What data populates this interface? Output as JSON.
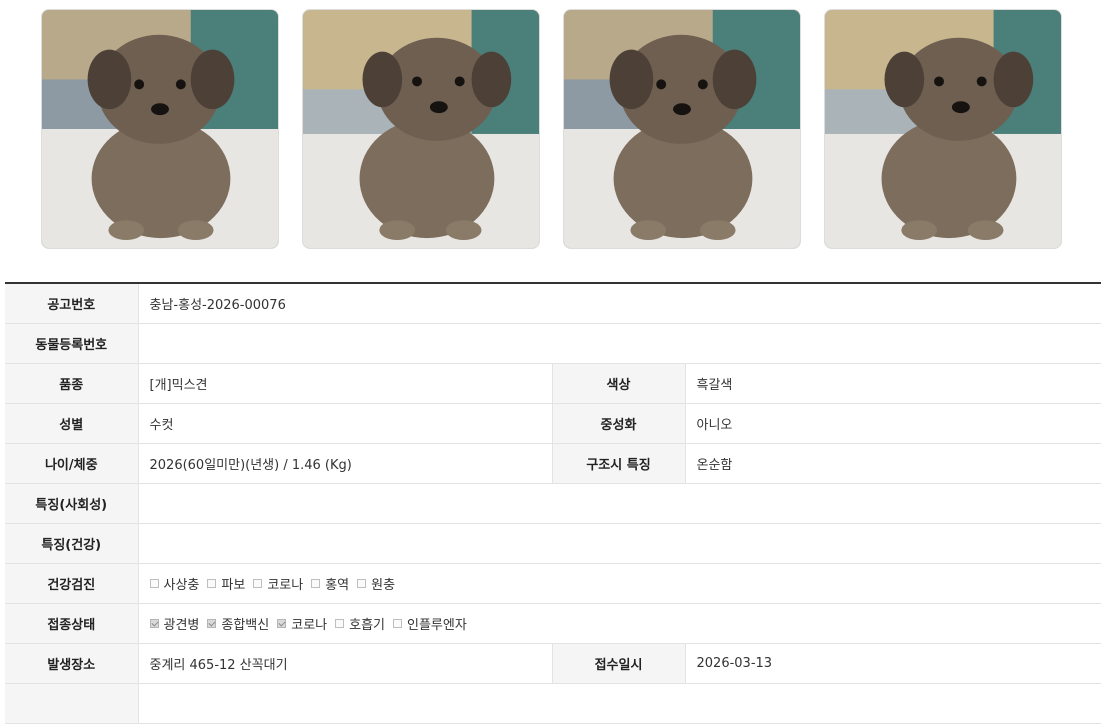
{
  "photos": [
    {
      "alt": "dog-photo-1"
    },
    {
      "alt": "dog-photo-2"
    },
    {
      "alt": "dog-photo-3"
    },
    {
      "alt": "dog-photo-4"
    }
  ],
  "info": {
    "notice_no": {
      "label": "공고번호",
      "value": "충남-홍성-2026-00076"
    },
    "reg_no": {
      "label": "동물등록번호",
      "value": ""
    },
    "breed": {
      "label": "품종",
      "value": "[개]믹스견"
    },
    "color": {
      "label": "색상",
      "value": "흑갈색"
    },
    "sex": {
      "label": "성별",
      "value": "수컷"
    },
    "neuter": {
      "label": "중성화",
      "value": "아니오"
    },
    "age_weight": {
      "label": "나이/체중",
      "value": "2026(60일미만)(년생) / 1.46 (Kg)"
    },
    "rescue_feature": {
      "label": "구조시 특징",
      "value": "온순함"
    },
    "feature_social": {
      "label": "특징(사회성)",
      "value": ""
    },
    "feature_health": {
      "label": "특징(건강)",
      "value": ""
    },
    "health_check": {
      "label": "건강검진",
      "items": [
        {
          "label": "사상충",
          "checked": false
        },
        {
          "label": "파보",
          "checked": false
        },
        {
          "label": "코로나",
          "checked": false
        },
        {
          "label": "홍역",
          "checked": false
        },
        {
          "label": "원충",
          "checked": false
        }
      ]
    },
    "vaccination": {
      "label": "접종상태",
      "items": [
        {
          "label": "광견병",
          "checked": true
        },
        {
          "label": "종합백신",
          "checked": true
        },
        {
          "label": "코로나",
          "checked": true
        },
        {
          "label": "호흡기",
          "checked": false
        },
        {
          "label": "인플루엔자",
          "checked": false
        }
      ]
    },
    "place": {
      "label": "발생장소",
      "value": "중계리 465-12 산꼭대기"
    },
    "receipt_date": {
      "label": "접수일시",
      "value": "2026-03-13"
    }
  }
}
